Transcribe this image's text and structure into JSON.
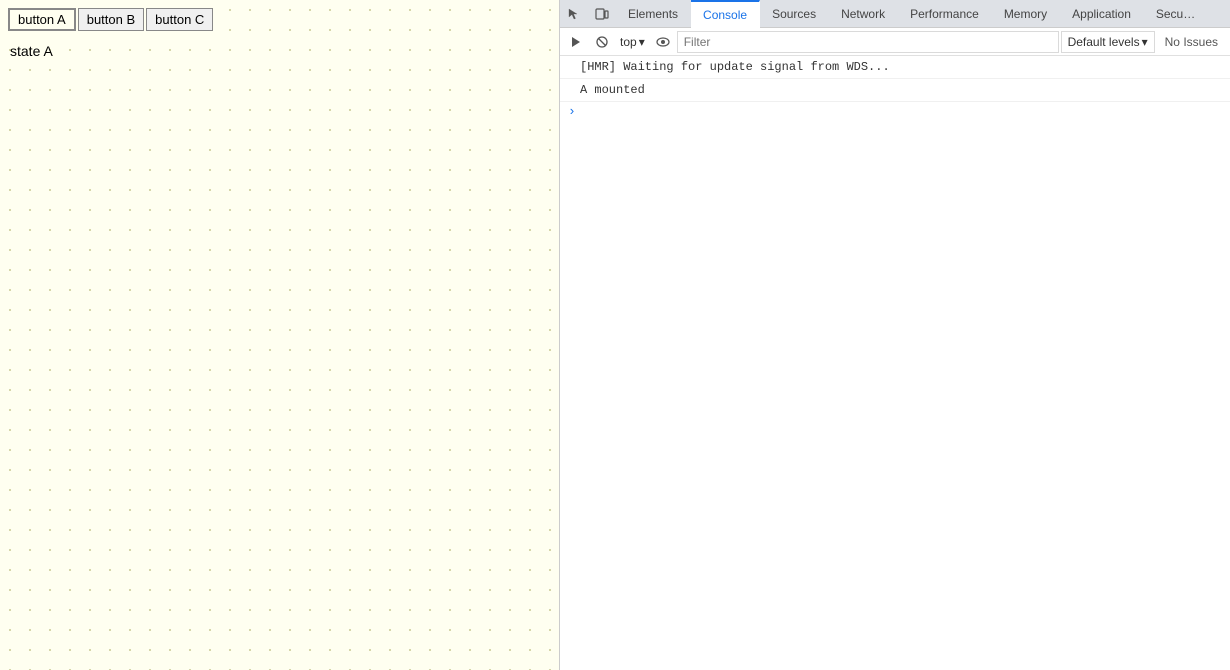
{
  "app": {
    "buttons": [
      {
        "id": "btn-a",
        "label": "button A",
        "active": true
      },
      {
        "id": "btn-b",
        "label": "button B",
        "active": false
      },
      {
        "id": "btn-c",
        "label": "button C",
        "active": false
      }
    ],
    "state_label": "state A"
  },
  "devtools": {
    "tabs": [
      {
        "id": "elements",
        "label": "Elements",
        "active": false
      },
      {
        "id": "console",
        "label": "Console",
        "active": true
      },
      {
        "id": "sources",
        "label": "Sources",
        "active": false
      },
      {
        "id": "network",
        "label": "Network",
        "active": false
      },
      {
        "id": "performance",
        "label": "Performance",
        "active": false
      },
      {
        "id": "memory",
        "label": "Memory",
        "active": false
      },
      {
        "id": "application",
        "label": "Application",
        "active": false
      },
      {
        "id": "security",
        "label": "Secu…",
        "active": false
      }
    ],
    "toolbar": {
      "context": "top",
      "filter_placeholder": "Filter",
      "default_levels": "Default levels",
      "no_issues": "No Issues"
    },
    "console_messages": [
      {
        "type": "hmr",
        "text": "[HMR] Waiting for update signal from WDS..."
      },
      {
        "type": "info",
        "text": "A mounted"
      }
    ]
  }
}
